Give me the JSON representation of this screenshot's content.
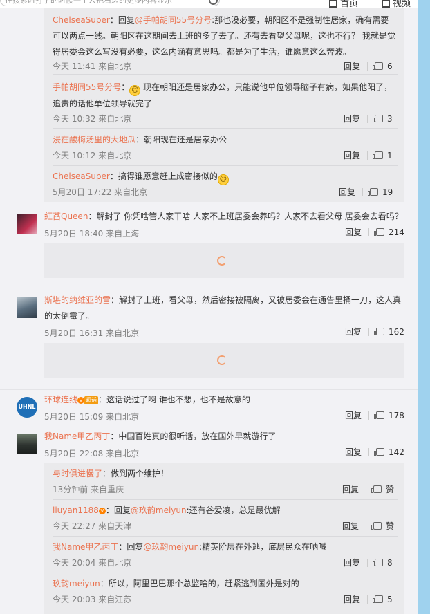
{
  "topbar": {
    "search_placeholder": "在搜索时打字的时候一个人把右边的更多内容显示",
    "nav_home": "首页",
    "nav_video": "视频"
  },
  "action_labels": {
    "reply": "回复"
  },
  "replies_a": [
    {
      "user": "ChelseaSuper",
      "text_before_at": "：回复",
      "at": "@手帕胡同55号分号",
      "text": ":那也没必要，朝阳区不是强制性居家，确有需要可以两点一线。朝阳区在这期间去上班的多了去了。还有去看望父母呢，这也不行？ 我就是觉得居委会这么写没有必要，这么内涵有意思吗。都是为了生活，谁愿意这么奔波。",
      "time": "今天 11:41 来自北京",
      "likes": "6"
    },
    {
      "user": "手帕胡同55号分号",
      "emoji": "smirk-face",
      "text": "现在朝阳还是居家办公，只能说他单位领导脑子有病，如果他阳了，追责的话他单位领导就完了",
      "time": "今天 10:32 来自北京",
      "likes": "3"
    },
    {
      "user": "浸在酸梅汤里的大地瓜",
      "text": "：朝阳现在还是居家办公",
      "time": "今天 10:12 来自北京",
      "likes": "1"
    },
    {
      "user": "ChelseaSuper",
      "text": "：搞得谁愿意赶上成密接似的",
      "emoji": "smile-face",
      "time": "5月20日 17:22 来自北京",
      "likes": "19"
    }
  ],
  "comments": [
    {
      "user": "紅萏Queen",
      "text": "：解封了 你凭啥管人家干啥 人家不上班居委会养吗？人家不去看父母 居委会去看吗？",
      "time": "5月20日 18:40 来自上海",
      "likes": "214"
    },
    {
      "user": "斯堪的纳维亚的雪",
      "text": "：解封了上班，看父母，然后密接被隔离，又被居委会在通告里捅一刀，这人真的太倒霉了。",
      "time": "5月20日 16:31 来自北京",
      "likes": "162"
    },
    {
      "user": "环球连线",
      "badge": "超话",
      "text": "：这话说过了啊 谁也不想，也不是故意的",
      "time": "5月20日 15:09 来自北京",
      "likes": "178",
      "avatar_text": "UHNL"
    },
    {
      "user": "我Name甲乙丙丁",
      "text": "：中国百姓真的很听话，放在国外早就游行了",
      "time": "5月20日 22:08 来自北京",
      "likes": "142"
    }
  ],
  "replies_b": [
    {
      "user": "与时俱进慢了",
      "text": "：做到两个维护！",
      "time": "13分钟前 来自重庆",
      "likes": "赞"
    },
    {
      "user": "liuyan1188",
      "text_before_at": "：回复",
      "at": "@玖韵meiyun",
      "text": ":还有谷爱凌，总是最优解",
      "time": "今天 22:27 来自天津",
      "likes": "赞"
    },
    {
      "user": "我Name甲乙丙丁",
      "text_before_at": "：回复",
      "at": "@玖韵meiyun",
      "text": ":精英阶层在外逃，底层民众在呐喊",
      "time": "今天 20:04 来自北京",
      "likes": "8"
    },
    {
      "user": "玖韵meiyun",
      "text": "：所以，阿里巴巴那个总监啥的，赶紧逃到国外是对的",
      "time": "今天 20:03 来自江苏",
      "likes": "5"
    }
  ]
}
